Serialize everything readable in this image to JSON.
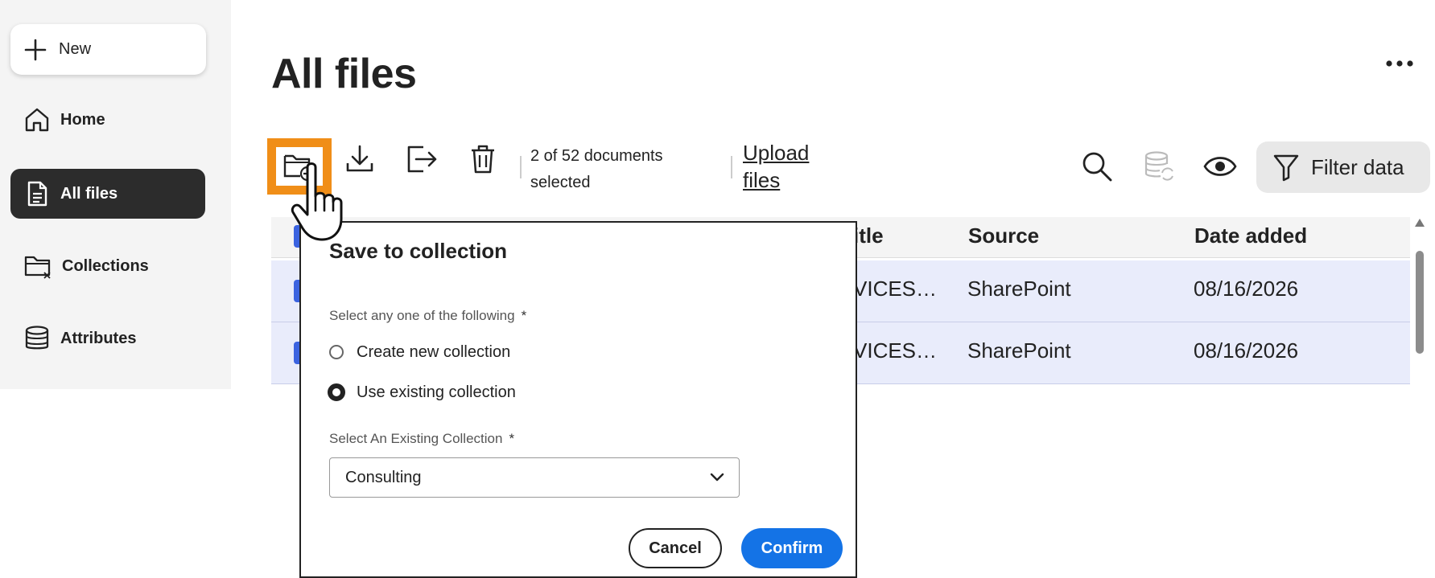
{
  "sidebar": {
    "new_label": "New",
    "items": [
      {
        "label": "Home",
        "icon": "home-icon",
        "active": false
      },
      {
        "label": "All files",
        "icon": "document-icon",
        "active": true
      },
      {
        "label": "Collections",
        "icon": "folder-icon",
        "active": false
      },
      {
        "label": "Attributes",
        "icon": "database-icon",
        "active": false
      }
    ]
  },
  "header": {
    "title": "All files",
    "more_icon": "more-horizontal-icon"
  },
  "toolbar": {
    "selection_text": "2 of 52 documents selected",
    "upload_label": "Upload files",
    "filter_label": "Filter data",
    "icons": [
      "add-to-collection-icon",
      "download-icon",
      "export-icon",
      "delete-icon",
      "search-icon",
      "sync-database-icon",
      "eye-icon",
      "filter-icon"
    ]
  },
  "table": {
    "columns": [
      "itle",
      "Source",
      "Date added"
    ],
    "rows": [
      {
        "title": "VICES…",
        "source": "SharePoint",
        "date": "08/16/2026"
      },
      {
        "title": "VICES…",
        "source": "SharePoint",
        "date": "08/16/2026"
      }
    ]
  },
  "dialog": {
    "title": "Save to collection",
    "choice_label": "Select any one of the following",
    "required_mark": "*",
    "options": [
      "Create new collection",
      "Use existing collection"
    ],
    "selected_option": "Use existing collection",
    "existing_label": "Select An Existing Collection",
    "existing_value": "Consulting",
    "cancel_label": "Cancel",
    "confirm_label": "Confirm"
  },
  "colors": {
    "highlight": "#f08e18",
    "primary": "#1473e6",
    "selected_row": "#e9ecfb",
    "checkbox": "#3b63e0",
    "active_nav": "#2c2c2c"
  }
}
